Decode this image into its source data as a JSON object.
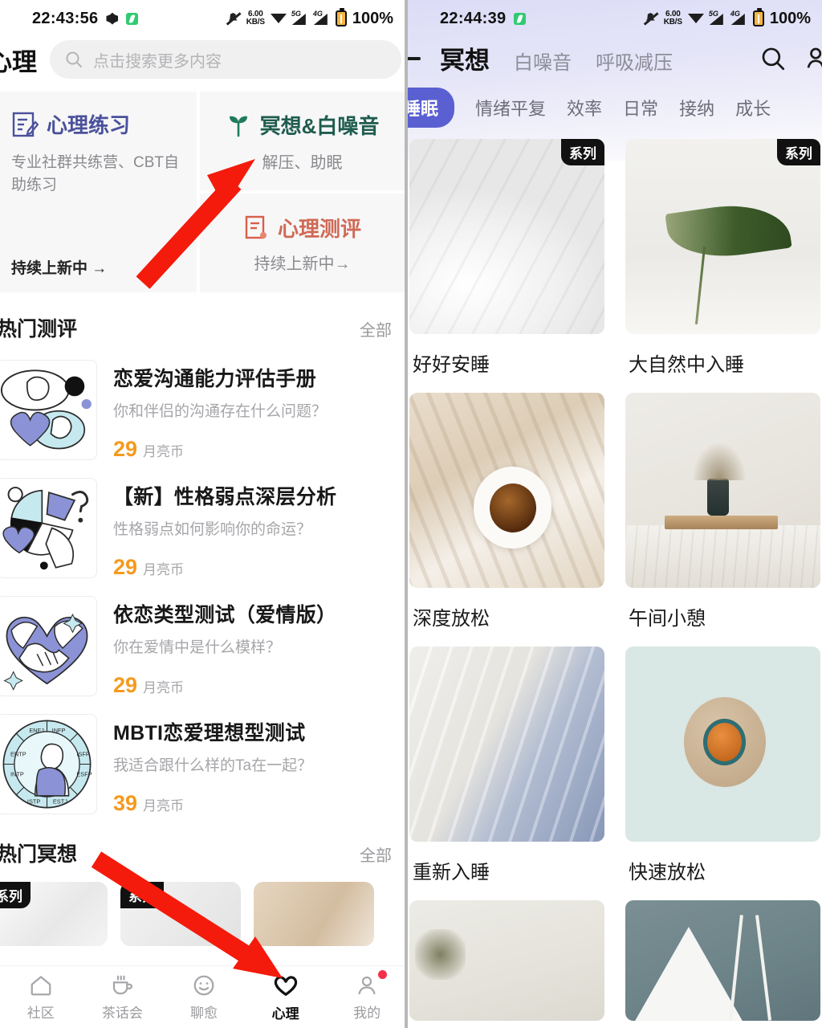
{
  "left": {
    "status": {
      "time": "22:43:56",
      "net_speed": "6.00",
      "net_unit": "KB/S",
      "sig1": "5G",
      "sig2": "4G",
      "battery": "100%"
    },
    "header": {
      "title": "心理",
      "search_placeholder": "点击搜索更多内容"
    },
    "cards": {
      "practice": {
        "title": "心理练习",
        "desc": "专业社群共练营、CBT自助练习",
        "more": "持续上新中 →",
        "color": "#4a519b"
      },
      "meditation": {
        "title": "冥想&白噪音",
        "sub": "解压、助眠",
        "color": "#1f5c4d"
      },
      "assessment": {
        "title": "心理测评",
        "sub": "持续上新中→",
        "color": "#d06a55"
      }
    },
    "hot_tests": {
      "section_title": "热门测评",
      "all_label": "全部",
      "items": [
        {
          "title": "恋爱沟通能力评估手册",
          "sub": "你和伴侣的沟通存在什么问题？",
          "price": "29",
          "unit": "月亮币",
          "thumb": "two-heads-talking"
        },
        {
          "title": "【新】性格弱点深层分析",
          "sub": "性格弱点如何影响你的命运？",
          "price": "29",
          "unit": "月亮币",
          "thumb": "pie-chart-question"
        },
        {
          "title": "依恋类型测试（爱情版）",
          "sub": "你在爱情中是什么模样？",
          "price": "29",
          "unit": "月亮币",
          "thumb": "holding-hands-heart"
        },
        {
          "title": "MBTI恋爱理想型测试",
          "sub": "我适合跟什么样的Ta在一起？",
          "price": "39",
          "unit": "月亮币",
          "thumb": "mbti-wheel-statue"
        }
      ]
    },
    "hot_meditation": {
      "section_title": "热门冥想",
      "all_label": "全部",
      "items": [
        {
          "badge": "系列",
          "art": "bedding"
        },
        {
          "badge": "系列",
          "art": "grey"
        },
        {
          "badge": "",
          "art": "tan"
        }
      ]
    },
    "bottom_nav": [
      {
        "label": "社区",
        "icon": "home-icon",
        "active": false,
        "dot": false
      },
      {
        "label": "茶话会",
        "icon": "cup-icon",
        "active": false,
        "dot": false
      },
      {
        "label": "聊愈",
        "icon": "smiley-icon",
        "active": false,
        "dot": false
      },
      {
        "label": "心理",
        "icon": "heart-icon",
        "active": true,
        "dot": false
      },
      {
        "label": "我的",
        "icon": "person-icon",
        "active": false,
        "dot": true
      }
    ]
  },
  "right": {
    "status": {
      "time": "22:44:39",
      "net_speed": "6.00",
      "net_unit": "KB/S",
      "sig1": "5G",
      "sig2": "4G",
      "battery": "100%"
    },
    "header": {
      "back_icon": "back-arrow-icon",
      "tabs": [
        {
          "label": "冥想",
          "active": true
        },
        {
          "label": "白噪音",
          "active": false
        },
        {
          "label": "呼吸减压",
          "active": false
        }
      ],
      "search_icon": "search-icon",
      "profile_icon": "person-add-icon"
    },
    "chips": [
      {
        "label": "睡眠",
        "active": true
      },
      {
        "label": "情绪平复",
        "active": false
      },
      {
        "label": "效率",
        "active": false
      },
      {
        "label": "日常",
        "active": false
      },
      {
        "label": "接纳",
        "active": false
      },
      {
        "label": "成长",
        "active": false
      }
    ],
    "grid": [
      {
        "label": "好好安睡",
        "badge": "系列",
        "art": "bedding"
      },
      {
        "label": "大自然中入睡",
        "badge": "系列",
        "art": "leaf"
      },
      {
        "label": "深度放松",
        "badge": "",
        "art": "tea"
      },
      {
        "label": "午间小憩",
        "badge": "",
        "art": "vase"
      },
      {
        "label": "重新入睡",
        "badge": "",
        "art": "bluebed"
      },
      {
        "label": "快速放松",
        "badge": "",
        "art": "mint"
      },
      {
        "label": "",
        "badge": "",
        "art": "dry"
      },
      {
        "label": "",
        "badge": "",
        "art": "teal"
      }
    ],
    "accent_color": "#5a5fd1"
  },
  "annotations": {
    "arrow_color": "#f41b0c",
    "arrows": [
      {
        "name": "arrow-to-meditation-card",
        "from": [
          176,
          352
        ],
        "to": [
          318,
          198
        ]
      },
      {
        "name": "arrow-to-psych-tab",
        "from": [
          118,
          1068
        ],
        "to": [
          352,
          1218
        ]
      }
    ]
  }
}
